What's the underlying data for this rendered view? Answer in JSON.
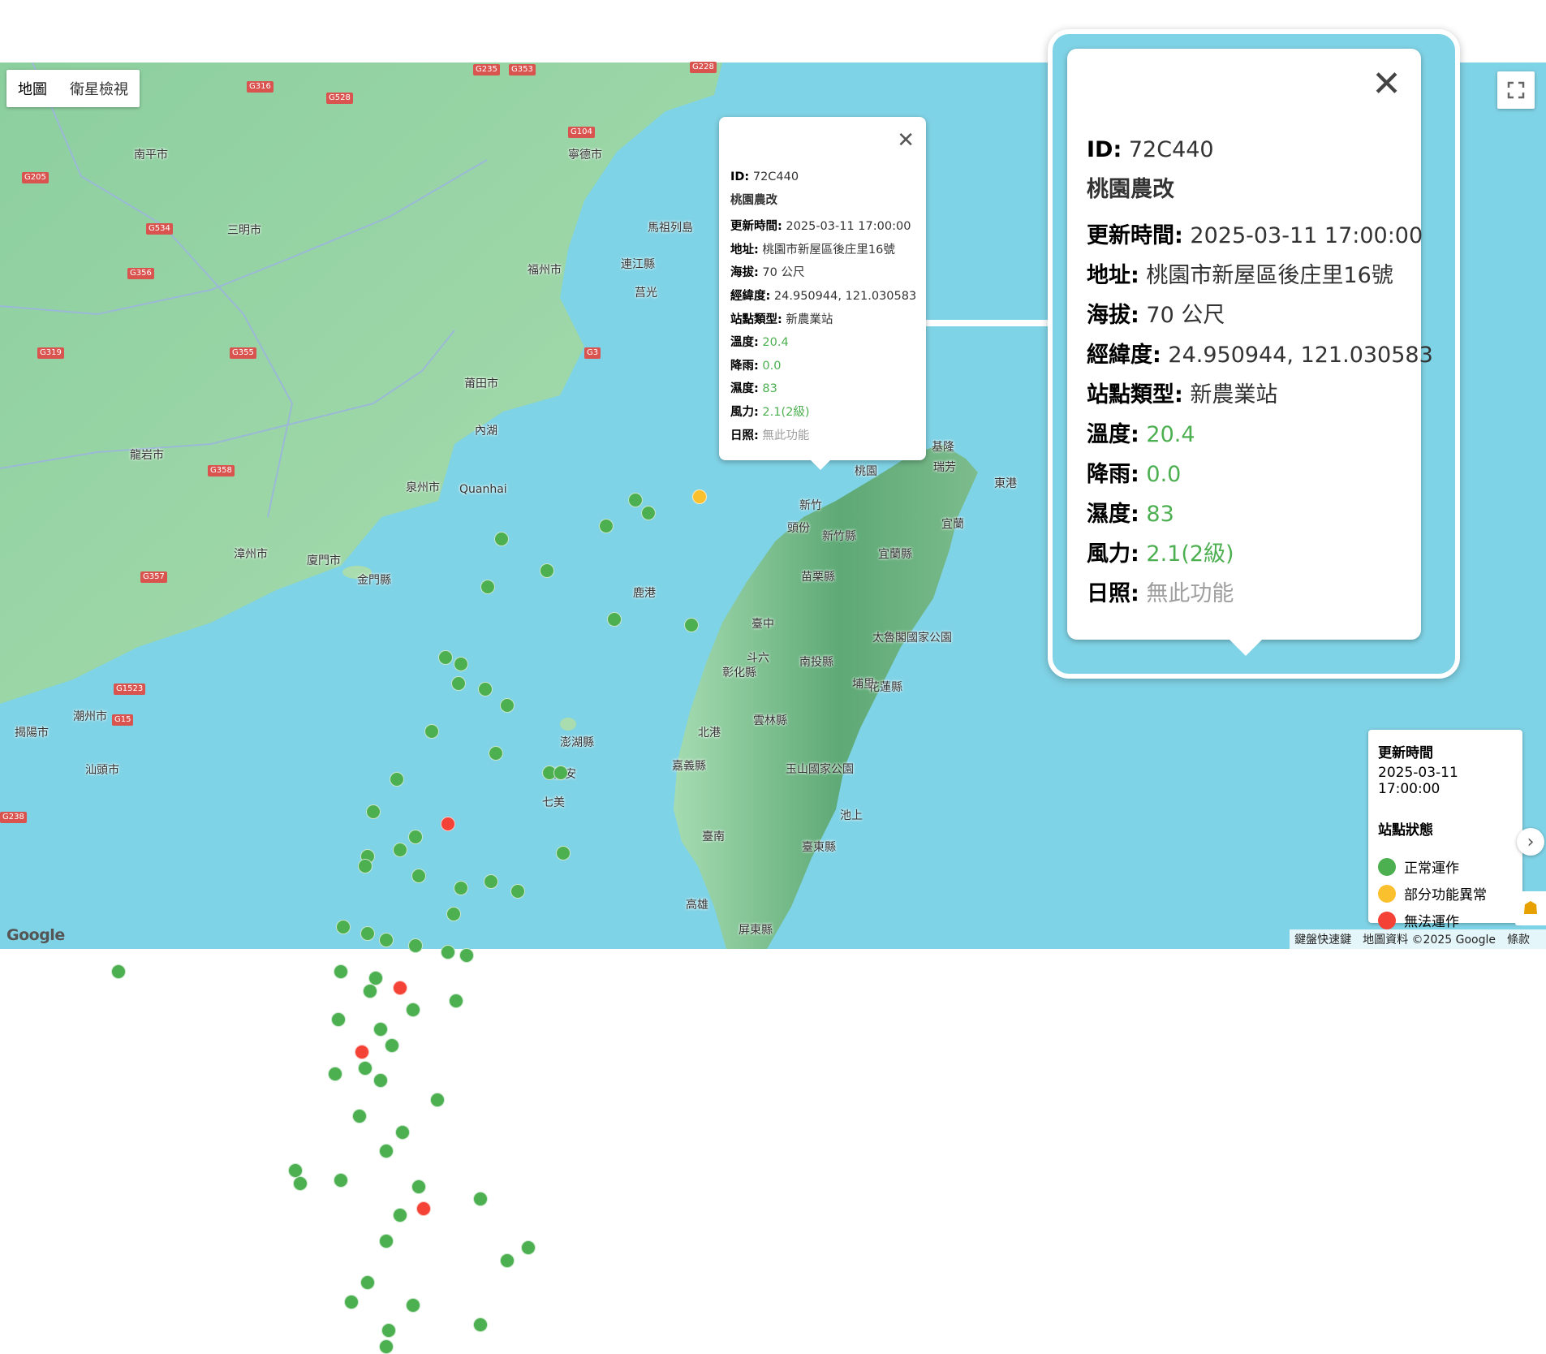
{
  "map_type": {
    "map_label": "地圖",
    "satellite_label": "衛星檢視"
  },
  "place_labels": [
    "南平市",
    "寧德市",
    "三明市",
    "福州市",
    "連江縣",
    "莒光",
    "莆田市",
    "泉州市",
    "廈門市",
    "漳州市",
    "金門縣",
    "龍岩市",
    "汕頭市",
    "揭陽市",
    "潮州市",
    "澎湖縣",
    "望安",
    "七美",
    "基隆",
    "桃園",
    "新竹",
    "新竹縣",
    "宜蘭縣",
    "苗栗縣",
    "臺中",
    "彰化縣",
    "南投縣",
    "埔里",
    "雲林縣",
    "嘉義縣",
    "臺南",
    "高雄",
    "屏東縣",
    "臺東縣",
    "花蓮縣",
    "太魯閣國家公園",
    "玉山國家公園",
    "池上",
    "馬祖列島",
    "Quanhai",
    "內湖",
    "頭份",
    "北港",
    "瑞芳",
    "宜蘭",
    "鹿港",
    "斗六",
    "東港"
  ],
  "road_labels": [
    "G316",
    "G528",
    "G235",
    "G353",
    "G228",
    "G205",
    "G104",
    "G534",
    "G356",
    "G319",
    "G355",
    "G3",
    "G358",
    "G357",
    "G1523",
    "G15",
    "G238"
  ],
  "infowindow": {
    "id_label": "ID:",
    "id_value": "72C440",
    "title": "桃園農改",
    "updated_label": "更新時間:",
    "updated_value": "2025-03-11 17:00:00",
    "address_label": "地址:",
    "address_value": "桃園市新屋區後庄里16號",
    "altitude_label": "海拔:",
    "altitude_value": "70 公尺",
    "latlng_label": "經緯度:",
    "latlng_value": "24.950944, 121.030583",
    "type_label": "站點類型:",
    "type_value": "新農業站",
    "temp_label": "溫度:",
    "temp_value": "20.4",
    "rain_label": "降雨:",
    "rain_value": "0.0",
    "humidity_label": "濕度:",
    "humidity_value": "83",
    "wind_label": "風力:",
    "wind_value": "2.1(2級)",
    "sunshine_label": "日照:",
    "sunshine_value": "無此功能"
  },
  "legend": {
    "updated_title": "更新時間",
    "updated_value": "2025-03-11 17:00:00",
    "status_title": "站點狀態",
    "ok_label": "正常運作",
    "warn_label": "部分功能異常",
    "err_label": "無法運作",
    "colors": {
      "ok": "#4caf50",
      "warn": "#fbc02d",
      "err": "#f44336"
    }
  },
  "attribution": {
    "logo": "Google",
    "shortcuts": "鍵盤快速鍵",
    "mapdata": "地圖資料 ©2025 Google",
    "terms": "條款"
  },
  "stations": [
    {
      "lat": 25.08,
      "lng": 121.77,
      "s": "warn"
    },
    {
      "lat": 25.03,
      "lng": 121.58,
      "s": "ok"
    },
    {
      "lat": 24.99,
      "lng": 121.42,
      "s": "ok"
    },
    {
      "lat": 25.07,
      "lng": 121.53,
      "s": "ok"
    },
    {
      "lat": 24.95,
      "lng": 121.03,
      "s": "ok"
    },
    {
      "lat": 24.85,
      "lng": 121.2,
      "s": "ok"
    },
    {
      "lat": 24.8,
      "lng": 120.98,
      "s": "ok"
    },
    {
      "lat": 24.68,
      "lng": 121.74,
      "s": "ok"
    },
    {
      "lat": 24.7,
      "lng": 121.45,
      "s": "ok"
    },
    {
      "lat": 24.58,
      "lng": 120.82,
      "s": "ok"
    },
    {
      "lat": 24.56,
      "lng": 120.88,
      "s": "ok"
    },
    {
      "lat": 24.5,
      "lng": 120.87,
      "s": "ok"
    },
    {
      "lat": 24.48,
      "lng": 120.97,
      "s": "ok"
    },
    {
      "lat": 24.43,
      "lng": 121.05,
      "s": "ok"
    },
    {
      "lat": 24.35,
      "lng": 120.77,
      "s": "ok"
    },
    {
      "lat": 24.28,
      "lng": 121.01,
      "s": "ok"
    },
    {
      "lat": 24.22,
      "lng": 121.21,
      "s": "ok"
    },
    {
      "lat": 24.22,
      "lng": 121.25,
      "s": "ok"
    },
    {
      "lat": 24.2,
      "lng": 120.64,
      "s": "ok"
    },
    {
      "lat": 24.1,
      "lng": 120.55,
      "s": "ok"
    },
    {
      "lat": 24.06,
      "lng": 120.83,
      "s": "err"
    },
    {
      "lat": 24.02,
      "lng": 120.71,
      "s": "ok"
    },
    {
      "lat": 23.98,
      "lng": 120.65,
      "s": "ok"
    },
    {
      "lat": 23.97,
      "lng": 121.26,
      "s": "ok"
    },
    {
      "lat": 23.96,
      "lng": 120.53,
      "s": "ok"
    },
    {
      "lat": 23.93,
      "lng": 120.52,
      "s": "ok"
    },
    {
      "lat": 23.9,
      "lng": 120.72,
      "s": "ok"
    },
    {
      "lat": 23.86,
      "lng": 120.88,
      "s": "ok"
    },
    {
      "lat": 23.88,
      "lng": 120.99,
      "s": "ok"
    },
    {
      "lat": 23.85,
      "lng": 121.09,
      "s": "ok"
    },
    {
      "lat": 23.78,
      "lng": 120.85,
      "s": "ok"
    },
    {
      "lat": 23.74,
      "lng": 120.44,
      "s": "ok"
    },
    {
      "lat": 23.72,
      "lng": 120.53,
      "s": "ok"
    },
    {
      "lat": 23.7,
      "lng": 120.6,
      "s": "ok"
    },
    {
      "lat": 23.68,
      "lng": 120.71,
      "s": "ok"
    },
    {
      "lat": 23.66,
      "lng": 120.83,
      "s": "ok"
    },
    {
      "lat": 23.65,
      "lng": 120.9,
      "s": "ok"
    },
    {
      "lat": 23.6,
      "lng": 120.43,
      "s": "ok"
    },
    {
      "lat": 23.58,
      "lng": 120.56,
      "s": "ok"
    },
    {
      "lat": 23.55,
      "lng": 120.65,
      "s": "err"
    },
    {
      "lat": 23.54,
      "lng": 120.54,
      "s": "ok"
    },
    {
      "lat": 23.51,
      "lng": 120.86,
      "s": "ok"
    },
    {
      "lat": 23.48,
      "lng": 120.7,
      "s": "ok"
    },
    {
      "lat": 23.45,
      "lng": 120.42,
      "s": "ok"
    },
    {
      "lat": 23.42,
      "lng": 120.58,
      "s": "ok"
    },
    {
      "lat": 23.37,
      "lng": 120.62,
      "s": "ok"
    },
    {
      "lat": 23.35,
      "lng": 120.51,
      "s": "err"
    },
    {
      "lat": 23.3,
      "lng": 120.52,
      "s": "ok"
    },
    {
      "lat": 23.28,
      "lng": 120.41,
      "s": "ok"
    },
    {
      "lat": 23.26,
      "lng": 120.58,
      "s": "ok"
    },
    {
      "lat": 23.2,
      "lng": 120.79,
      "s": "ok"
    },
    {
      "lat": 23.15,
      "lng": 120.5,
      "s": "ok"
    },
    {
      "lat": 23.1,
      "lng": 120.66,
      "s": "ok"
    },
    {
      "lat": 23.04,
      "lng": 120.6,
      "s": "ok"
    },
    {
      "lat": 22.98,
      "lng": 120.26,
      "s": "ok"
    },
    {
      "lat": 22.94,
      "lng": 120.28,
      "s": "ok"
    },
    {
      "lat": 22.95,
      "lng": 120.43,
      "s": "ok"
    },
    {
      "lat": 22.93,
      "lng": 120.72,
      "s": "ok"
    },
    {
      "lat": 22.89,
      "lng": 120.95,
      "s": "ok"
    },
    {
      "lat": 22.86,
      "lng": 120.74,
      "s": "err"
    },
    {
      "lat": 22.84,
      "lng": 120.65,
      "s": "ok"
    },
    {
      "lat": 22.76,
      "lng": 120.6,
      "s": "ok"
    },
    {
      "lat": 22.74,
      "lng": 121.13,
      "s": "ok"
    },
    {
      "lat": 22.7,
      "lng": 121.05,
      "s": "ok"
    },
    {
      "lat": 22.63,
      "lng": 120.53,
      "s": "ok"
    },
    {
      "lat": 22.57,
      "lng": 120.47,
      "s": "ok"
    },
    {
      "lat": 22.56,
      "lng": 120.7,
      "s": "ok"
    },
    {
      "lat": 22.5,
      "lng": 120.95,
      "s": "ok"
    },
    {
      "lat": 22.48,
      "lng": 120.61,
      "s": "ok"
    },
    {
      "lat": 22.43,
      "lng": 120.6,
      "s": "ok"
    },
    {
      "lat": 23.6,
      "lng": 119.6,
      "s": "ok"
    }
  ]
}
